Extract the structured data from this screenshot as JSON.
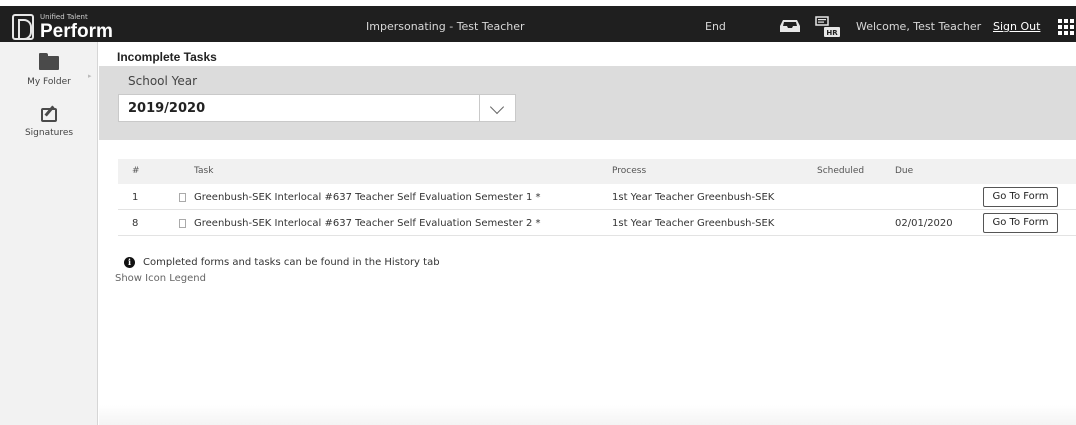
{
  "header": {
    "logo_small": "Unified Talent",
    "logo_big": "Perform",
    "impersonating": "Impersonating - Test Teacher",
    "end_label": "End",
    "welcome": "Welcome, Test Teacher",
    "signout": "Sign Out",
    "icons": [
      "tray-icon",
      "hr-icon",
      "app-grid-icon"
    ]
  },
  "sidebar": {
    "items": [
      {
        "label": "My Folder",
        "icon": "folder-icon"
      },
      {
        "label": "Signatures",
        "icon": "signature-icon"
      }
    ]
  },
  "page": {
    "title": "Incomplete Tasks",
    "school_year_label": "School Year",
    "school_year_value": "2019/2020"
  },
  "table": {
    "headers": {
      "num": "#",
      "task": "Task",
      "process": "Process",
      "scheduled": "Scheduled",
      "due": "Due"
    },
    "rows": [
      {
        "num": "1",
        "task": "Greenbush-SEK Interlocal #637 Teacher Self Evaluation Semester 1 *",
        "process": "1st Year Teacher Greenbush-SEK",
        "scheduled": "",
        "due": "",
        "action": "Go To Form"
      },
      {
        "num": "8",
        "task": "Greenbush-SEK Interlocal #637 Teacher Self Evaluation Semester 2 *",
        "process": "1st Year Teacher Greenbush-SEK",
        "scheduled": "",
        "due": "02/01/2020",
        "action": "Go To Form"
      }
    ]
  },
  "footer": {
    "info_text": "Completed forms and tasks can be found in the History tab",
    "legend_link": "Show Icon Legend"
  }
}
